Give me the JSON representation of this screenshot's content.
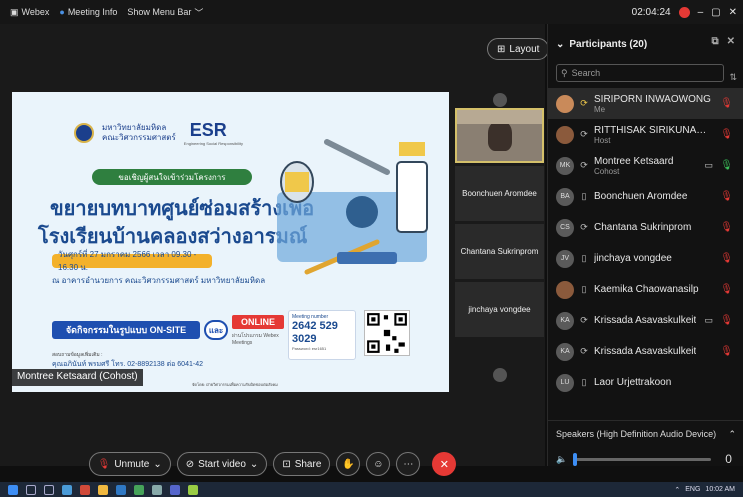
{
  "titlebar": {
    "app": "Webex",
    "meeting_info": "Meeting Info",
    "show_menu_bar": "Show Menu Bar",
    "timer": "02:04:24"
  },
  "stage": {
    "layout_label": "Layout",
    "share_label": "Montree Ketsaard (Cohost)",
    "tiles": [
      "Boonchuen Aromdee",
      "Chantana Sukrinprom",
      "jinchaya vongdee"
    ]
  },
  "slide": {
    "uni_line1": "มหาวิทยาลัยมหิดล",
    "uni_line2": "คณะวิศวกรรมศาสตร์",
    "esr": "ESR",
    "esr_sub": "Engineering Social Responsibility",
    "invite": "ขอเชิญผู้สนใจเข้าร่วมโครงการ",
    "headline1": "ขยายบทบาทศูนย์ซ่อมสร้างเพื่อ",
    "headline2": "โรงเรียนบ้านคลองสว่างอารมณ์",
    "date": "วันศุกร์ที่ 27 มกราคม 2566 เวลา 09.30 - 16.30 น.",
    "place": "ณ อาคารอำนวยการ คณะวิศวกรรมศาสตร์ มหาวิทยาลัยมหิดล",
    "onsite": "จัดกิจกรรมในรูปแบบ ON-SITE",
    "and": "และ",
    "online": "ONLINE",
    "webex_mini": "ผ่านโปรแกรม Webex Meetings",
    "meeting_label": "Meeting number",
    "meeting_number": "2642 529 3029",
    "password": "Password: esr1651",
    "contact_label": "สอบถามข้อมูลเพิ่มเติม :",
    "contact": "คุณอภินันท์ พรมศรี โทร. 02-8892138 ต่อ 6041-42",
    "footer": "จัดโดย: ฝ่ายวิศวกรรมเพื่อความรับผิดชอบต่อสังคม"
  },
  "participants": {
    "title": "Participants (20)",
    "search_placeholder": "Search",
    "list": [
      {
        "name": "SIRIPORN INWAOWONG",
        "sub": "Me",
        "initials": "",
        "status": "speaking"
      },
      {
        "name": "RITTHISAK SIRIKUNASAKUL...",
        "sub": "Host",
        "initials": "",
        "status": "speaking"
      },
      {
        "name": "Montree Ketsaard",
        "sub": "Cohost",
        "initials": "MK",
        "status": "speaking"
      },
      {
        "name": "Boonchuen Aromdee",
        "sub": "",
        "initials": "BA",
        "status": "device"
      },
      {
        "name": "Chantana Sukrinprom",
        "sub": "",
        "initials": "CS",
        "status": "speaking"
      },
      {
        "name": "jinchaya vongdee",
        "sub": "",
        "initials": "JV",
        "status": "device"
      },
      {
        "name": "Kaemika Chaowanasilp",
        "sub": "",
        "initials": "",
        "status": "device"
      },
      {
        "name": "Krissada Asavaskulkeit",
        "sub": "",
        "initials": "KA",
        "status": "speaking"
      },
      {
        "name": "Krissada Asavaskulkeit",
        "sub": "",
        "initials": "KA",
        "status": "speaking"
      },
      {
        "name": "Laor Urjettrakoon",
        "sub": "",
        "initials": "LU",
        "status": "device"
      }
    ]
  },
  "audio": {
    "speaker_device": "Speakers (High Definition Audio Device)",
    "volume_value": "0",
    "volume_fraction": 0
  },
  "controls": {
    "unmute": "Unmute",
    "start_video": "Start video",
    "share": "Share"
  },
  "taskbar": {
    "lang": "ENG",
    "time": "10:02 AM"
  },
  "colors": {
    "accent": "#3d8ef5",
    "danger": "#e53935",
    "panel_bg": "#121212"
  }
}
